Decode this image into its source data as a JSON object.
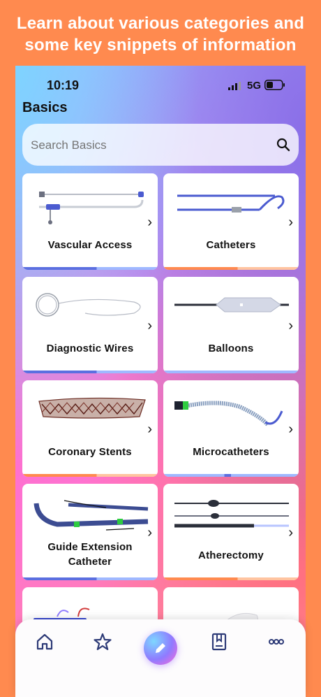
{
  "headline": "Learn about various categories and some key snippets of information",
  "status_bar": {
    "time": "10:19",
    "network": "5G"
  },
  "page_title": "Basics",
  "search": {
    "placeholder": "Search Basics"
  },
  "cards": [
    {
      "label": "Vascular Access"
    },
    {
      "label": "Catheters"
    },
    {
      "label": "Diagnostic Wires"
    },
    {
      "label": "Balloons"
    },
    {
      "label": "Coronary Stents"
    },
    {
      "label": "Microcatheters"
    },
    {
      "label": "Guide Extension\nCatheter"
    },
    {
      "label": "Atherectomy"
    },
    {
      "label": ""
    },
    {
      "label": ""
    }
  ],
  "chevron": "›",
  "bottom_nav": {
    "items": [
      {
        "icon": "home-icon"
      },
      {
        "icon": "star-icon"
      },
      {
        "icon": "edit-pencil-icon"
      },
      {
        "icon": "book-bookmark-icon"
      },
      {
        "icon": "more-dots-icon"
      }
    ]
  },
  "colors": {
    "page_background": "#ff8a4f",
    "accent_blue": "#5b6fe0",
    "accent_orange": "#ff8a4f",
    "icon_navy": "#2d3a77"
  }
}
